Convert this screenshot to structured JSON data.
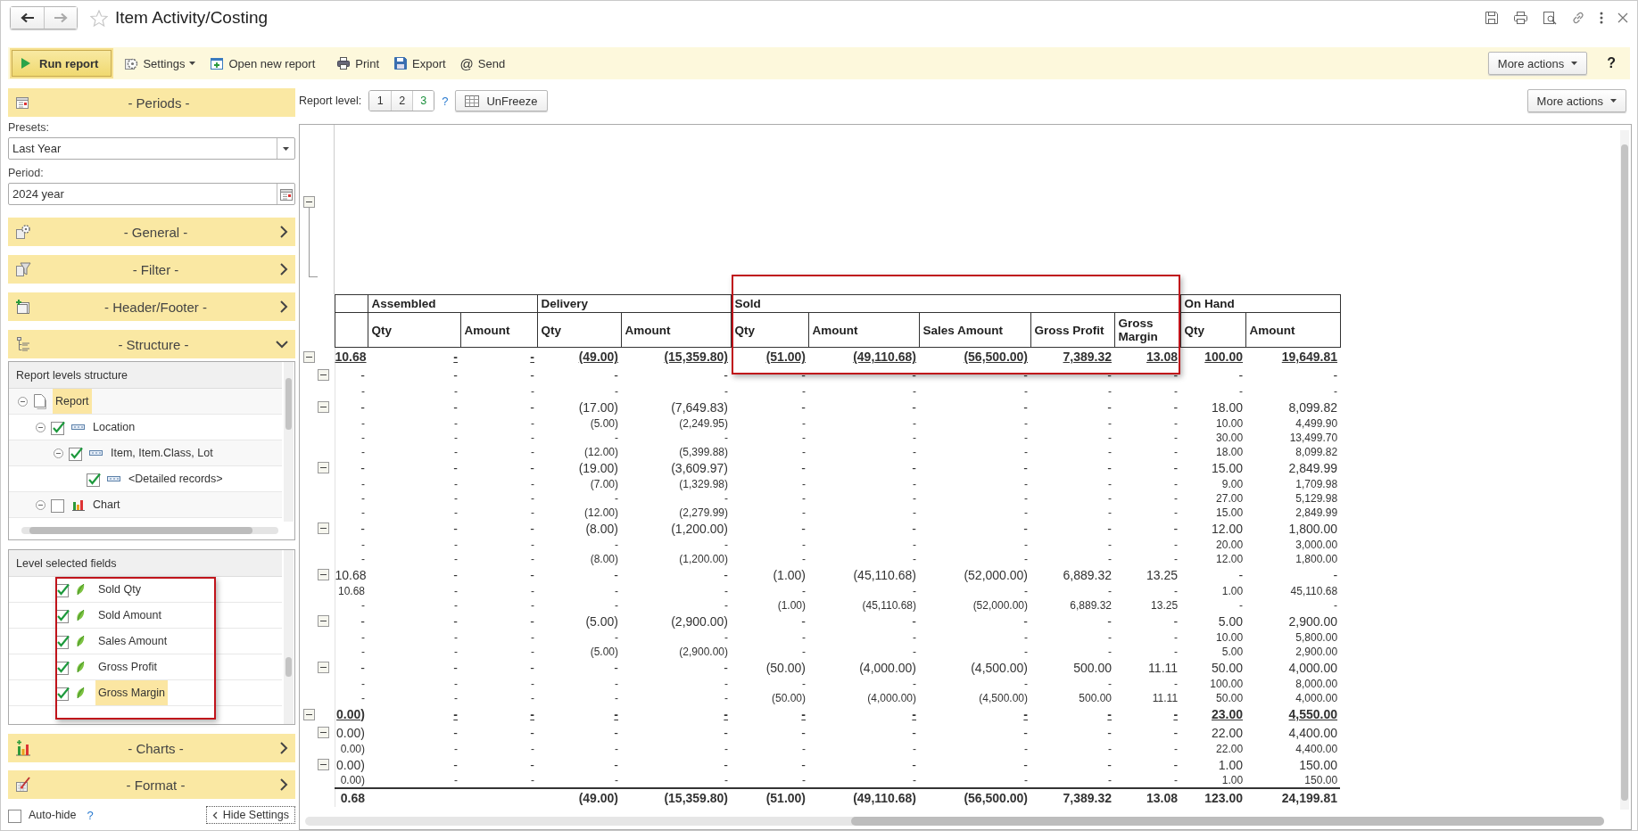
{
  "window": {
    "title": "Item Activity/Costing"
  },
  "toolbar": {
    "run_button": "Run report",
    "items": [
      {
        "kind": "settings",
        "label": "Settings",
        "dropdown": true
      },
      {
        "kind": "new",
        "label": "Open new report"
      },
      {
        "kind": "print",
        "label": "Print"
      },
      {
        "kind": "export",
        "label": "Export"
      },
      {
        "kind": "send",
        "glyph": "@",
        "label": "Send"
      }
    ],
    "more_actions": "More actions",
    "help": "?"
  },
  "settings": {
    "periods": {
      "kind": "periods",
      "title": "- Periods -"
    },
    "presets": {
      "label": "Presets:",
      "value": "Last Year"
    },
    "period": {
      "label": "Period:",
      "value": "2024 year"
    },
    "sections": [
      {
        "kind": "general",
        "title": "- General -",
        "expanded": false
      },
      {
        "kind": "filter",
        "title": "- Filter -",
        "expanded": false
      },
      {
        "kind": "header_footer",
        "title": "- Header/Footer -",
        "expanded": false
      },
      {
        "kind": "structure",
        "title": "- Structure -",
        "expanded": true
      }
    ],
    "levels_structure": {
      "title": "Report levels structure",
      "items": [
        {
          "kind": "report",
          "label": "Report",
          "selected": true,
          "expanded": true,
          "children": [
            {
              "kind": "grouping",
              "label": "Location",
              "checked": true,
              "selected": false,
              "expanded": true,
              "children": [
                {
                  "kind": "grouping",
                  "label": "Item, Item.Class, Lot",
                  "checked": true,
                  "selected": false,
                  "expanded": true,
                  "children": [
                    {
                      "kind": "grouping",
                      "label": "<Detailed records>",
                      "checked": true,
                      "selected": false
                    }
                  ]
                }
              ]
            },
            {
              "kind": "chart",
              "label": "Chart",
              "checked": false,
              "selected": false,
              "expanded": true
            }
          ]
        }
      ]
    },
    "selected_fields": {
      "title": "Level selected fields",
      "items": [
        {
          "label": "Sold Qty",
          "checked": true,
          "selected": false
        },
        {
          "label": "Sold Amount",
          "checked": true,
          "selected": false
        },
        {
          "label": "Sales Amount",
          "checked": true,
          "selected": false
        },
        {
          "label": "Gross Profit",
          "checked": true,
          "selected": false
        },
        {
          "label": "Gross Margin",
          "checked": true,
          "selected": true
        }
      ]
    },
    "more_sections": [
      {
        "kind": "charts",
        "title": "- Charts -",
        "expanded": false
      },
      {
        "kind": "format",
        "title": "- Format -",
        "expanded": false
      }
    ],
    "auto_hide": {
      "label": "Auto-hide",
      "checked": false,
      "help": "?"
    },
    "hide_button": "Hide Settings"
  },
  "report": {
    "level_label": "Report level:",
    "levels": [
      {
        "label": "1",
        "selected": false
      },
      {
        "label": "2",
        "selected": false
      },
      {
        "label": "3",
        "selected": true
      }
    ],
    "help": "?",
    "unfreeze": "UnFreeze",
    "more_actions": "More actions",
    "table": {
      "groups": [
        {
          "label": "Assembled",
          "columns": [
            "Qty",
            "Amount"
          ]
        },
        {
          "label": "Delivery",
          "columns": [
            "Qty",
            "Amount"
          ]
        },
        {
          "label": "Sold",
          "columns": [
            "Qty",
            "Amount",
            "Sales Amount",
            "Gross Profit",
            "Gross Margin"
          ]
        },
        {
          "label": "On Hand",
          "columns": [
            "Qty",
            "Amount"
          ]
        }
      ],
      "rows": [
        {
          "kind": "group",
          "expanded": true,
          "cells": [
            "10.68",
            "-",
            "-",
            "(49.00)",
            "(15,359.80)",
            "(51.00)",
            "(49,110.68)",
            "(56,500.00)",
            "7,389.32",
            "13.08",
            "100.00",
            "19,649.81"
          ],
          "children": [
            {
              "expanded": true,
              "cells": [
                "-",
                "-",
                "-",
                "-",
                "-",
                "-",
                "-",
                "-",
                "-",
                "-",
                "-",
                "-"
              ],
              "children": [
                {
                  "cells": [
                    "-",
                    "-",
                    "-",
                    "-",
                    "-",
                    "-",
                    "-",
                    "-",
                    "-",
                    "-",
                    "-",
                    "-"
                  ]
                }
              ]
            },
            {
              "expanded": true,
              "cells": [
                "-",
                "-",
                "-",
                "(17.00)",
                "(7,649.83)",
                "-",
                "-",
                "-",
                "-",
                "-",
                "18.00",
                "8,099.82"
              ],
              "children": [
                {
                  "cells": [
                    "-",
                    "-",
                    "-",
                    "(5.00)",
                    "(2,249.95)",
                    "-",
                    "-",
                    "-",
                    "-",
                    "-",
                    "10.00",
                    "4,499.90"
                  ]
                },
                {
                  "cells": [
                    "-",
                    "-",
                    "-",
                    "-",
                    "-",
                    "-",
                    "-",
                    "-",
                    "-",
                    "-",
                    "30.00",
                    "13,499.70"
                  ]
                },
                {
                  "cells": [
                    "-",
                    "-",
                    "-",
                    "(12.00)",
                    "(5,399.88)",
                    "-",
                    "-",
                    "-",
                    "-",
                    "-",
                    "18.00",
                    "8,099.82"
                  ]
                }
              ]
            },
            {
              "expanded": true,
              "cells": [
                "-",
                "-",
                "-",
                "(19.00)",
                "(3,609.97)",
                "-",
                "-",
                "-",
                "-",
                "-",
                "15.00",
                "2,849.99"
              ],
              "children": [
                {
                  "cells": [
                    "-",
                    "-",
                    "-",
                    "(7.00)",
                    "(1,329.98)",
                    "-",
                    "-",
                    "-",
                    "-",
                    "-",
                    "9.00",
                    "1,709.98"
                  ]
                },
                {
                  "cells": [
                    "-",
                    "-",
                    "-",
                    "-",
                    "-",
                    "-",
                    "-",
                    "-",
                    "-",
                    "-",
                    "27.00",
                    "5,129.98"
                  ]
                },
                {
                  "cells": [
                    "-",
                    "-",
                    "-",
                    "(12.00)",
                    "(2,279.99)",
                    "-",
                    "-",
                    "-",
                    "-",
                    "-",
                    "15.00",
                    "2,849.99"
                  ]
                }
              ]
            },
            {
              "expanded": true,
              "cells": [
                "-",
                "-",
                "-",
                "(8.00)",
                "(1,200.00)",
                "-",
                "-",
                "-",
                "-",
                "-",
                "12.00",
                "1,800.00"
              ],
              "children": [
                {
                  "cells": [
                    "-",
                    "-",
                    "-",
                    "-",
                    "-",
                    "-",
                    "-",
                    "-",
                    "-",
                    "-",
                    "20.00",
                    "3,000.00"
                  ]
                },
                {
                  "cells": [
                    "-",
                    "-",
                    "-",
                    "(8.00)",
                    "(1,200.00)",
                    "-",
                    "-",
                    "-",
                    "-",
                    "-",
                    "12.00",
                    "1,800.00"
                  ]
                }
              ]
            },
            {
              "expanded": true,
              "cells": [
                "10.68",
                "-",
                "-",
                "-",
                "-",
                "(1.00)",
                "(45,110.68)",
                "(52,000.00)",
                "6,889.32",
                "13.25",
                "-",
                "-"
              ],
              "children": [
                {
                  "cells": [
                    "10.68",
                    "-",
                    "-",
                    "-",
                    "-",
                    "-",
                    "-",
                    "-",
                    "-",
                    "-",
                    "1.00",
                    "45,110.68"
                  ]
                },
                {
                  "cells": [
                    "-",
                    "-",
                    "-",
                    "-",
                    "-",
                    "(1.00)",
                    "(45,110.68)",
                    "(52,000.00)",
                    "6,889.32",
                    "13.25",
                    "-",
                    "-"
                  ]
                }
              ]
            },
            {
              "expanded": true,
              "cells": [
                "-",
                "-",
                "-",
                "(5.00)",
                "(2,900.00)",
                "-",
                "-",
                "-",
                "-",
                "-",
                "5.00",
                "2,900.00"
              ],
              "children": [
                {
                  "cells": [
                    "-",
                    "-",
                    "-",
                    "-",
                    "-",
                    "-",
                    "-",
                    "-",
                    "-",
                    "-",
                    "10.00",
                    "5,800.00"
                  ]
                },
                {
                  "cells": [
                    "-",
                    "-",
                    "-",
                    "(5.00)",
                    "(2,900.00)",
                    "-",
                    "-",
                    "-",
                    "-",
                    "-",
                    "5.00",
                    "2,900.00"
                  ]
                }
              ]
            },
            {
              "expanded": true,
              "cells": [
                "-",
                "-",
                "-",
                "-",
                "-",
                "(50.00)",
                "(4,000.00)",
                "(4,500.00)",
                "500.00",
                "11.11",
                "50.00",
                "4,000.00"
              ],
              "children": [
                {
                  "cells": [
                    "-",
                    "-",
                    "-",
                    "-",
                    "-",
                    "-",
                    "-",
                    "-",
                    "-",
                    "-",
                    "100.00",
                    "8,000.00"
                  ]
                },
                {
                  "cells": [
                    "-",
                    "-",
                    "-",
                    "-",
                    "-",
                    "(50.00)",
                    "(4,000.00)",
                    "(4,500.00)",
                    "500.00",
                    "11.11",
                    "50.00",
                    "4,000.00"
                  ]
                }
              ]
            }
          ]
        },
        {
          "kind": "group",
          "expanded": true,
          "cells": [
            "0.00)",
            "-",
            "-",
            "-",
            "-",
            "-",
            "-",
            "-",
            "-",
            "-",
            "23.00",
            "4,550.00"
          ],
          "children": [
            {
              "expanded": true,
              "cells": [
                "0.00)",
                "-",
                "-",
                "-",
                "-",
                "-",
                "-",
                "-",
                "-",
                "-",
                "22.00",
                "4,400.00"
              ],
              "children": [
                {
                  "cells": [
                    "0.00)",
                    "-",
                    "-",
                    "-",
                    "-",
                    "-",
                    "-",
                    "-",
                    "-",
                    "-",
                    "22.00",
                    "4,400.00"
                  ]
                }
              ]
            },
            {
              "expanded": true,
              "cells": [
                "0.00)",
                "-",
                "-",
                "-",
                "-",
                "-",
                "-",
                "-",
                "-",
                "-",
                "1.00",
                "150.00"
              ],
              "children": [
                {
                  "cells": [
                    "0.00)",
                    "-",
                    "-",
                    "-",
                    "-",
                    "-",
                    "-",
                    "-",
                    "-",
                    "-",
                    "1.00",
                    "150.00"
                  ]
                }
              ]
            }
          ]
        },
        {
          "kind": "grand_total",
          "cells": [
            "0.68",
            null,
            null,
            "(49.00)",
            "(15,359.80)",
            "(51.00)",
            "(49,110.68)",
            "(56,500.00)",
            "7,389.32",
            "13.08",
            "123.00",
            "24,199.81"
          ]
        }
      ]
    }
  }
}
